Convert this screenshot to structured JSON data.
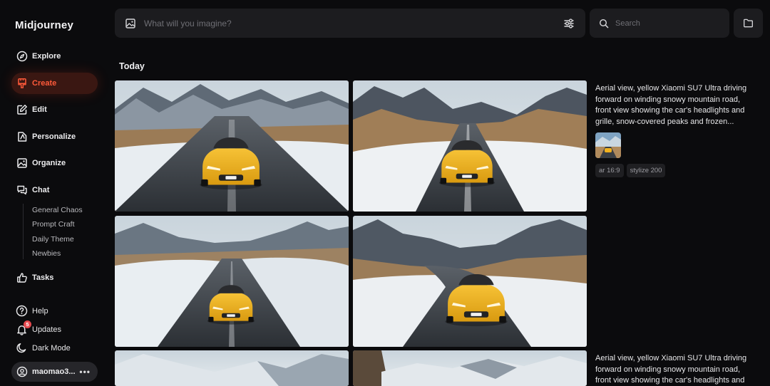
{
  "app": {
    "brand": "Midjourney"
  },
  "nav": {
    "explore": "Explore",
    "create": "Create",
    "edit": "Edit",
    "personalize": "Personalize",
    "organize": "Organize",
    "chat": "Chat",
    "chat_rooms": [
      "General Chaos",
      "Prompt Craft",
      "Daily Theme",
      "Newbies"
    ],
    "tasks": "Tasks"
  },
  "bottom": {
    "help": "Help",
    "updates": "Updates",
    "updates_badge": "5",
    "dark_mode": "Dark Mode",
    "user": "maomao3...",
    "more": "•••"
  },
  "prompt": {
    "placeholder": "What will you imagine?"
  },
  "search": {
    "placeholder": "Search"
  },
  "feed": {
    "section_title": "Today",
    "jobs": [
      {
        "prompt": "Aerial view, yellow Xiaomi SU7 Ultra driving forward on winding snowy mountain road, front view showing the car's headlights and grille, snow-covered peaks and frozen...",
        "params": [
          "ar 16:9",
          "stylize 200"
        ]
      },
      {
        "prompt": "Aerial view, yellow Xiaomi SU7 Ultra driving forward on winding snowy mountain road, front view showing the car's headlights and"
      }
    ]
  },
  "colors": {
    "accent": "#ff5a3a",
    "active_bg": "#3a1712",
    "car_yellow": "#f2b21e",
    "panel": "#1c1c1f",
    "background": "#0b0b0d"
  },
  "icons": {
    "explore": "compass-icon",
    "create": "brush-icon",
    "edit": "pencil-square-icon",
    "personalize": "personalize-icon",
    "organize": "image-frame-icon",
    "chat": "chat-bubbles-icon",
    "tasks": "thumbs-up-icon",
    "help": "question-circle-icon",
    "updates": "bell-icon",
    "dark_mode": "moon-icon",
    "user": "user-circle-icon"
  }
}
